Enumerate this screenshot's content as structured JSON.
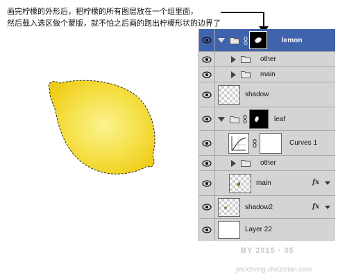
{
  "caption": {
    "line1": "画完柠檬的外形后，把柠檬的所有图层放在一个组里面，",
    "line2": "然后载入选区做个蒙版，就不怕之后画的跑出柠檬形状的边界了"
  },
  "layers": [
    {
      "name": "lemon",
      "type": "group",
      "expanded": true,
      "selected": true
    },
    {
      "name": "other",
      "type": "group",
      "expanded": false
    },
    {
      "name": "main",
      "type": "group",
      "expanded": false
    },
    {
      "name": "shadow",
      "type": "layer"
    },
    {
      "name": "leaf",
      "type": "group",
      "expanded": true
    },
    {
      "name": "Curves 1",
      "type": "adjustment"
    },
    {
      "name": "other",
      "type": "group",
      "expanded": false
    },
    {
      "name": "main",
      "type": "layer",
      "effects": "fx"
    },
    {
      "name": "shadow2",
      "type": "layer",
      "effects": "fx"
    },
    {
      "name": "Layer 22",
      "type": "layer"
    }
  ],
  "fx_label": "fx",
  "watermark": {
    "line1": "BY 2015 · 35",
    "line2": "jiaocheng.chazidian.com"
  },
  "colors": {
    "lemon_outer": "#f2d31e",
    "lemon_inner": "#faf290",
    "selected_row": "#3f63ac",
    "panel_bg": "#d4d4d4"
  },
  "icons": [
    "eye-icon",
    "folder-icon",
    "chain-link-icon",
    "expand-triangle-icon",
    "collapse-triangle-icon",
    "curves-icon",
    "arrow-icon"
  ]
}
